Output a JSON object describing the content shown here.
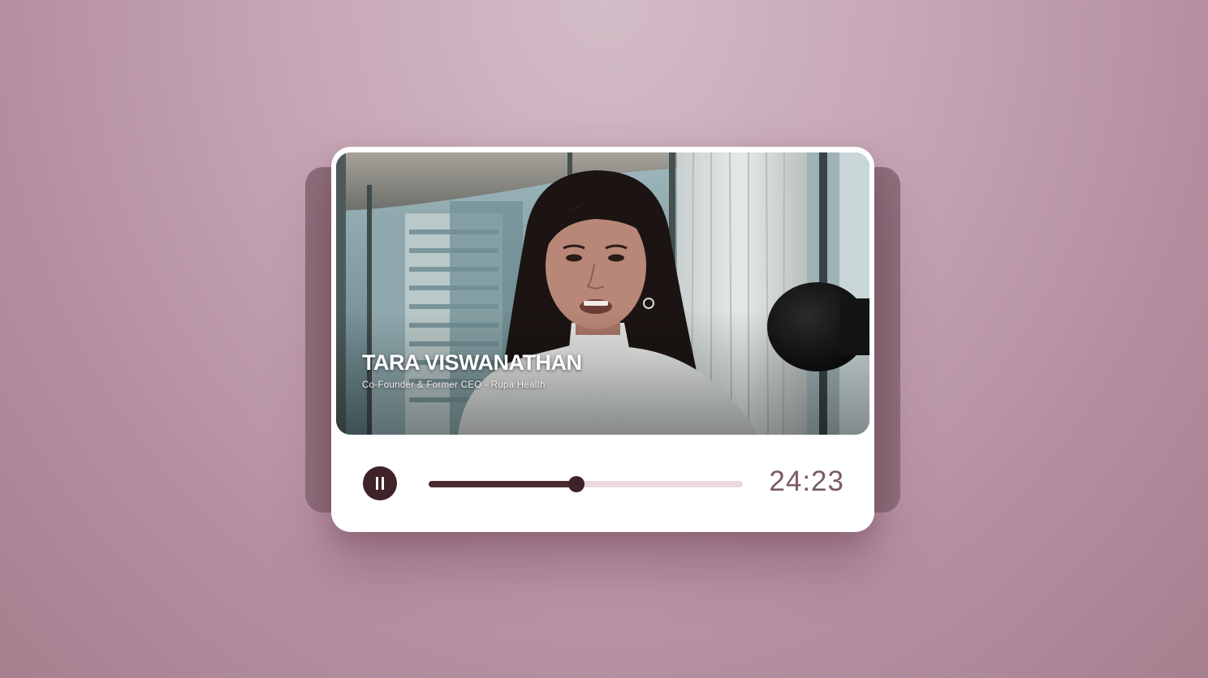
{
  "video": {
    "speaker_name": "TARA VISWANATHAN",
    "speaker_title": "Co-Founder & Former CEO - Rupa Health"
  },
  "player": {
    "state": "playing",
    "pause_icon": "pause-icon",
    "progress_fraction": 0.47,
    "time_display": "24:23"
  },
  "colors": {
    "accent_dark": "#3e2329",
    "track_empty": "#ead9e0",
    "time_text": "#7a5a64",
    "background": "#c7a7b6"
  }
}
